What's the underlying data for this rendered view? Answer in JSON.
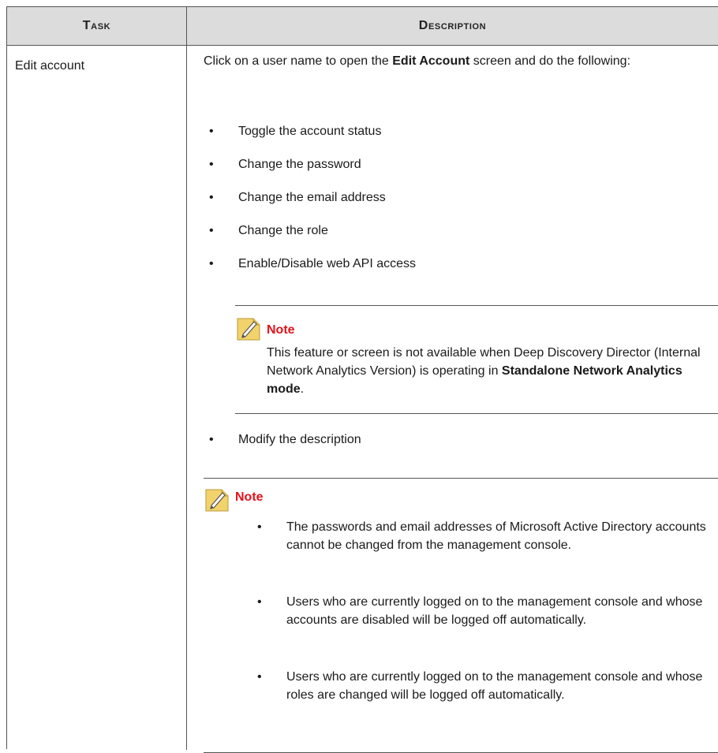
{
  "table": {
    "headers": {
      "task": "Task",
      "description": "Description"
    },
    "task": "Edit account",
    "intro_before": "Click on a user name to open the ",
    "intro_bold": "Edit Account",
    "intro_after": " screen and do the following:",
    "bullets": [
      "Toggle the account status",
      "Change the password",
      "Change the email address",
      "Change the role",
      "Enable/Disable web API access"
    ],
    "bullet_after_note": "Modify the description",
    "note1": {
      "title": "Note",
      "body_before": "This feature or screen is not available when Deep Discovery Director (Internal Network Analytics Version) is operating in ",
      "body_bold": "Standalone Network Analytics mode",
      "body_after": "."
    },
    "note2": {
      "title": "Note",
      "items": [
        "The passwords and email addresses of Microsoft Active Directory accounts cannot be changed from the management console.",
        "Users who are currently logged on to the management console and whose accounts are disabled will be logged off automatically.",
        "Users who are currently logged on to the management console and whose roles are changed will be logged off automatically."
      ]
    },
    "bullet_char": "•",
    "note_icon": "note-pencil-icon",
    "colors": {
      "header_bg": "#dcdcdc",
      "note_title": "#e3121b",
      "icon_yellow": "#f2d36b"
    }
  }
}
